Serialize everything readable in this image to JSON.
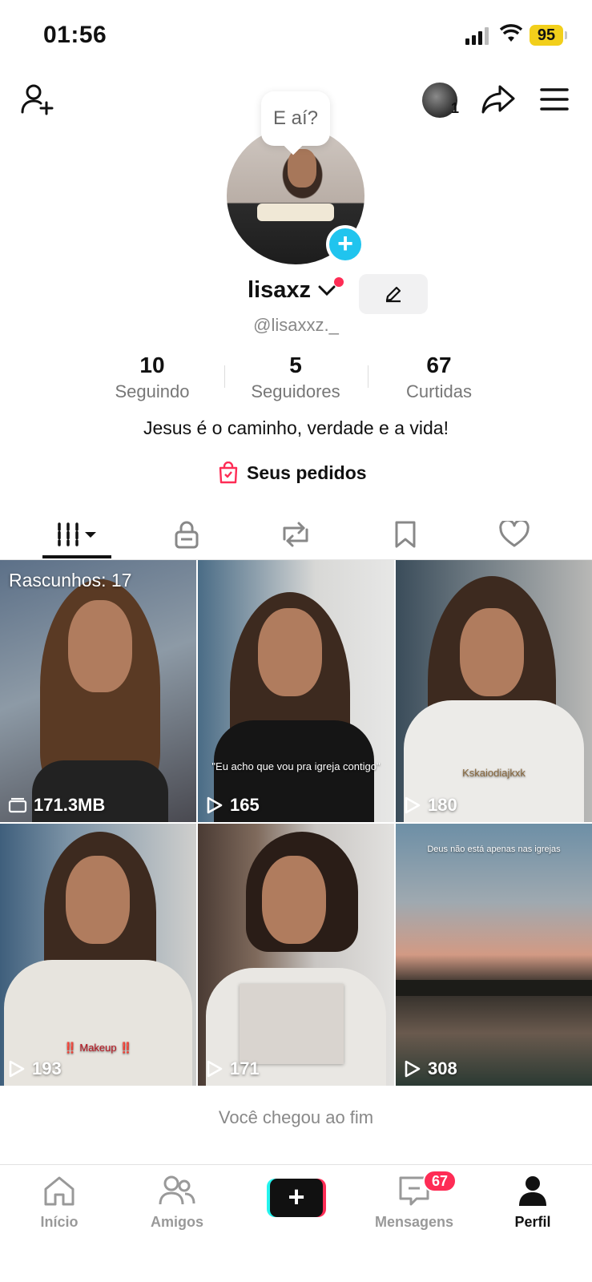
{
  "status_bar": {
    "time": "01:56",
    "battery": "95"
  },
  "header": {
    "viewer_count": "1"
  },
  "profile": {
    "bubble_text": "E aí?",
    "name": "lisaxz",
    "handle": "@lisaxxz._",
    "bio": "Jesus é o caminho, verdade e a vida!",
    "orders_label": "Seus pedidos"
  },
  "stats": [
    {
      "value": "10",
      "label": "Seguindo"
    },
    {
      "value": "5",
      "label": "Seguidores"
    },
    {
      "value": "67",
      "label": "Curtidas"
    }
  ],
  "tabs": [
    {
      "icon": "grid-icon",
      "active": true
    },
    {
      "icon": "lock-icon"
    },
    {
      "icon": "repost-icon"
    },
    {
      "icon": "bookmark-icon"
    },
    {
      "icon": "heart-icon"
    }
  ],
  "videos": [
    {
      "drafts": "Rascunhos: 17",
      "stat": "171.3MB",
      "stat_icon": "folder-icon"
    },
    {
      "stat": "165",
      "stat_icon": "play-icon",
      "caption": "\"Eu acho que vou pra igreja contigo\""
    },
    {
      "stat": "180",
      "stat_icon": "play-icon",
      "caption": "Kskaiodiajkxk"
    },
    {
      "stat": "193",
      "stat_icon": "play-icon",
      "caption": "‼️ Makeup ‼️"
    },
    {
      "stat": "171",
      "stat_icon": "play-icon"
    },
    {
      "stat": "308",
      "stat_icon": "play-icon",
      "caption": "Deus não está apenas nas igrejas"
    }
  ],
  "end_text": "Você chegou ao fim",
  "nav": {
    "home": "Início",
    "friends": "Amigos",
    "messages": "Mensagens",
    "messages_badge": "67",
    "profile": "Perfil"
  },
  "colors": {
    "accent_cyan": "#25f4ee",
    "accent_red": "#fe2c55",
    "battery": "#f2cf1b"
  }
}
